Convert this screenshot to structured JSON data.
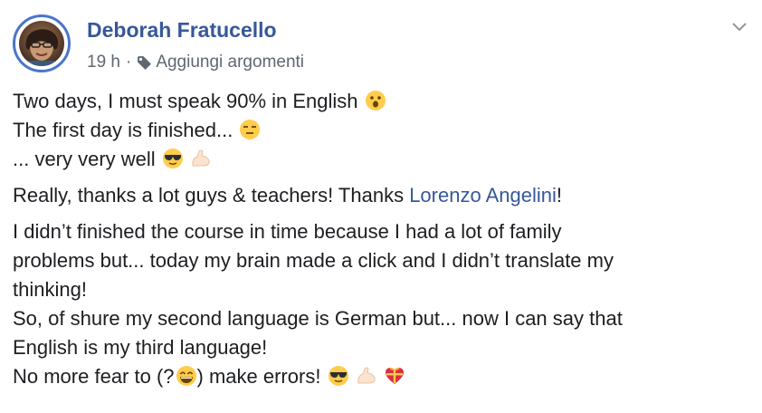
{
  "post": {
    "author": "Deborah Fratucello",
    "time": "19 h",
    "separator": "·",
    "add_topics": "Aggiungi argomenti",
    "line1": "Two days, I must speak 90% in English",
    "line2": "The first day is finished...",
    "line3": "... very very well",
    "thanks_prefix": "Really, thanks a lot guys & teachers! Thanks ",
    "mention": "Lorenzo Angelini",
    "thanks_suffix": "!",
    "p3_line1": "I didn’t finished the course in time because I had a lot of family",
    "p3_line2": "problems but... today my brain made a click and I didn’t translate my",
    "p3_line3": "thinking!",
    "p3_line4": "So, of shure my second language is German but... now I can say that",
    "p3_line5": "English is my third language!",
    "p3_line6a": "No more fear to (?",
    "p3_line6b": ") make errors!"
  },
  "icons": {
    "tag": "tag-icon",
    "chevron": "chevron-down-icon",
    "emoji_surprised": "surprised-emoji",
    "emoji_expressionless": "expressionless-emoji",
    "emoji_sunglasses": "sunglasses-emoji",
    "emoji_muscle": "flexed-biceps-emoji",
    "emoji_grin": "grinning-emoji",
    "emoji_heart_gift": "heart-with-ribbon-emoji"
  },
  "colors": {
    "author_link": "#365899",
    "meta_text": "#606770",
    "body_text": "#1c1e21",
    "avatar_ring": "#4a76c9"
  }
}
